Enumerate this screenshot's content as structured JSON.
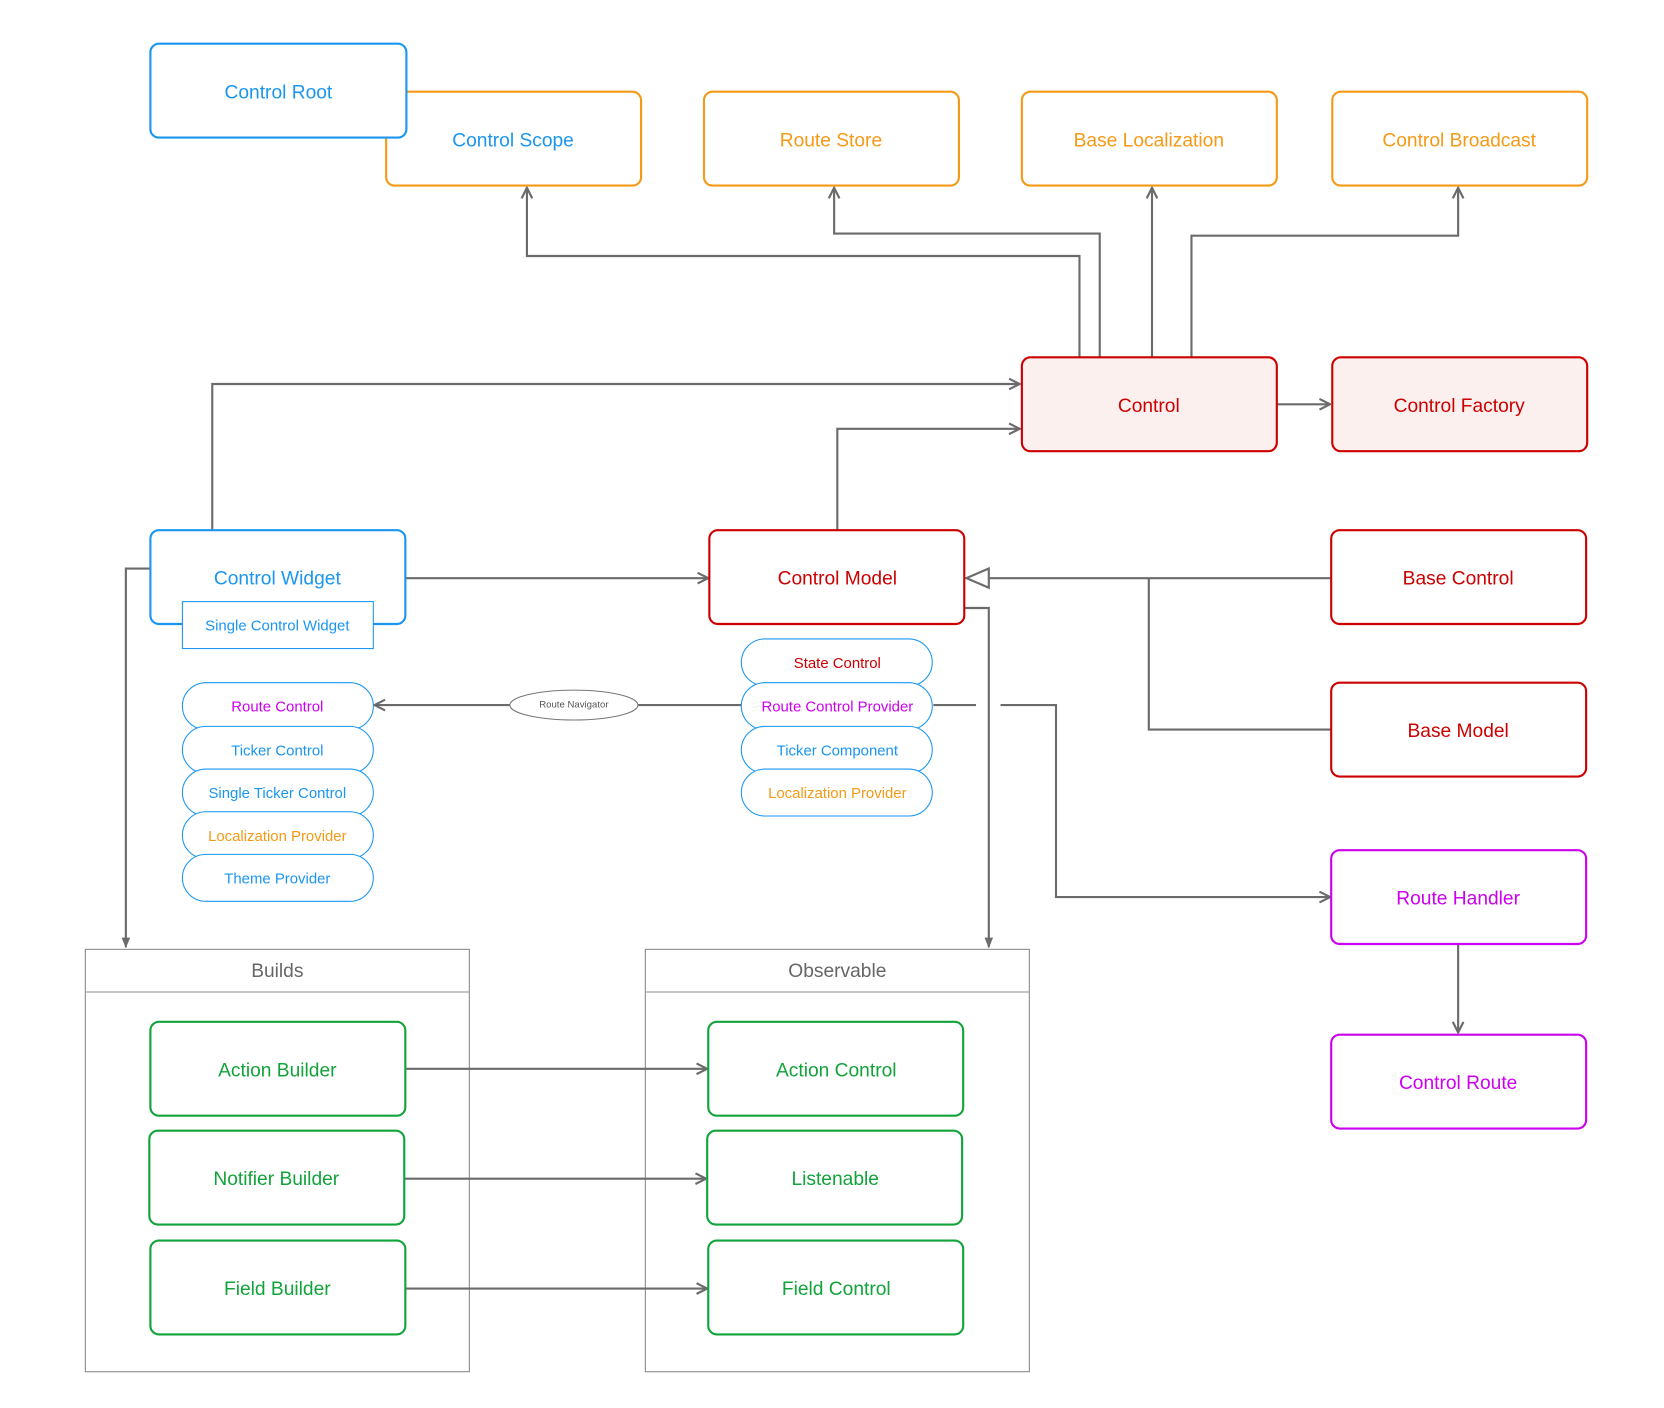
{
  "colors": {
    "blue": "#1a96f0",
    "orange": "#f59a16",
    "red": "#cc0000",
    "red_fill": "#fcf0ef",
    "green": "#12a33a",
    "purple": "#cc00ee",
    "edge": "#6b6b6b",
    "container": "#888888"
  },
  "nodes": {
    "control_root": "Control Root",
    "control_scope": "Control Scope",
    "route_store": "Route Store",
    "base_localization": "Base Localization",
    "control_broadcast": "Control Broadcast",
    "control": "Control",
    "control_factory": "Control Factory",
    "control_widget": "Control Widget",
    "single_control_widget": "Single Control Widget",
    "control_model": "Control Model",
    "base_control": "Base Control",
    "base_model": "Base Model",
    "route_handler": "Route Handler",
    "control_route": "Control Route"
  },
  "widget_mixins": [
    "Route Control",
    "Ticker Control",
    "Single Ticker Control",
    "Localization Provider",
    "Theme Provider"
  ],
  "model_mixins": [
    "State Control",
    "Route Control Provider",
    "Ticker Component",
    "Localization Provider"
  ],
  "edge_label": "Route Navigator",
  "containers": {
    "builds": {
      "title": "Builds",
      "items": [
        "Action Builder",
        "Notifier Builder",
        "Field Builder"
      ]
    },
    "observable": {
      "title": "Observable",
      "items": [
        "Action Control",
        "Listenable",
        "Field Control"
      ]
    }
  }
}
